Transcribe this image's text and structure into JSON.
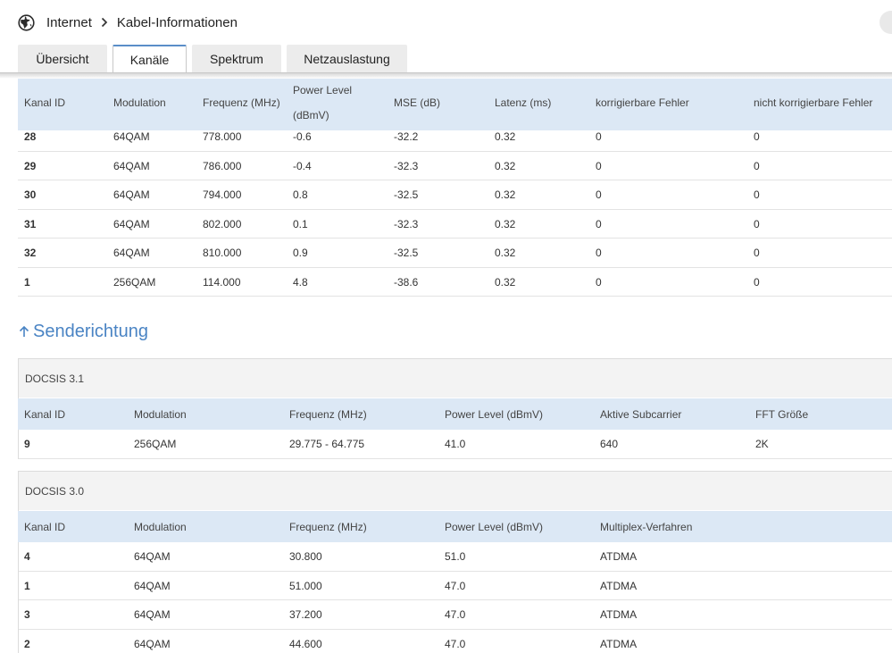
{
  "breadcrumb": {
    "root": "Internet",
    "current": "Kabel-Informationen"
  },
  "tabs": [
    {
      "label": "Übersicht",
      "active": false
    },
    {
      "label": "Kanäle",
      "active": true
    },
    {
      "label": "Spektrum",
      "active": false
    },
    {
      "label": "Netzauslastung",
      "active": false
    }
  ],
  "downstream": {
    "headers": [
      "Kanal ID",
      "Modulation",
      "Frequenz (MHz)",
      "Power Level",
      "(dBmV)",
      "MSE (dB)",
      "Latenz (ms)",
      "korrigierbare Fehler",
      "nicht korrigierbare Fehler"
    ],
    "rows": [
      [
        "28",
        "64QAM",
        "778.000",
        "-0.6",
        "-32.2",
        "0.32",
        "0",
        "0"
      ],
      [
        "29",
        "64QAM",
        "786.000",
        "-0.4",
        "-32.3",
        "0.32",
        "0",
        "0"
      ],
      [
        "30",
        "64QAM",
        "794.000",
        "0.8",
        "-32.5",
        "0.32",
        "0",
        "0"
      ],
      [
        "31",
        "64QAM",
        "802.000",
        "0.1",
        "-32.3",
        "0.32",
        "0",
        "0"
      ],
      [
        "32",
        "64QAM",
        "810.000",
        "0.9",
        "-32.5",
        "0.32",
        "0",
        "0"
      ],
      [
        "1",
        "256QAM",
        "114.000",
        "4.8",
        "-38.6",
        "0.32",
        "0",
        "0"
      ]
    ]
  },
  "upstream": {
    "title": "Senderichtung",
    "docsis31": {
      "label": "DOCSIS 3.1",
      "headers": [
        "Kanal ID",
        "Modulation",
        "Frequenz (MHz)",
        "Power Level (dBmV)",
        "Aktive Subcarrier",
        "FFT Größe"
      ],
      "rows": [
        [
          "9",
          "256QAM",
          "29.775 - 64.775",
          "41.0",
          "640",
          "2K"
        ]
      ]
    },
    "docsis30": {
      "label": "DOCSIS 3.0",
      "headers": [
        "Kanal ID",
        "Modulation",
        "Frequenz (MHz)",
        "Power Level (dBmV)",
        "Multiplex-Verfahren"
      ],
      "rows": [
        [
          "4",
          "64QAM",
          "30.800",
          "51.0",
          "ATDMA"
        ],
        [
          "1",
          "64QAM",
          "51.000",
          "47.0",
          "ATDMA"
        ],
        [
          "3",
          "64QAM",
          "37.200",
          "47.0",
          "ATDMA"
        ],
        [
          "2",
          "64QAM",
          "44.600",
          "47.0",
          "ATDMA"
        ]
      ]
    }
  },
  "colors": {
    "accent": "#4a84c4",
    "header_bg": "#dce8f5",
    "tab_bg": "#ececec"
  },
  "icons": {
    "breadcrumb": "globe-icon",
    "separator": "chevron-right-icon",
    "section": "arrow-up-icon"
  }
}
